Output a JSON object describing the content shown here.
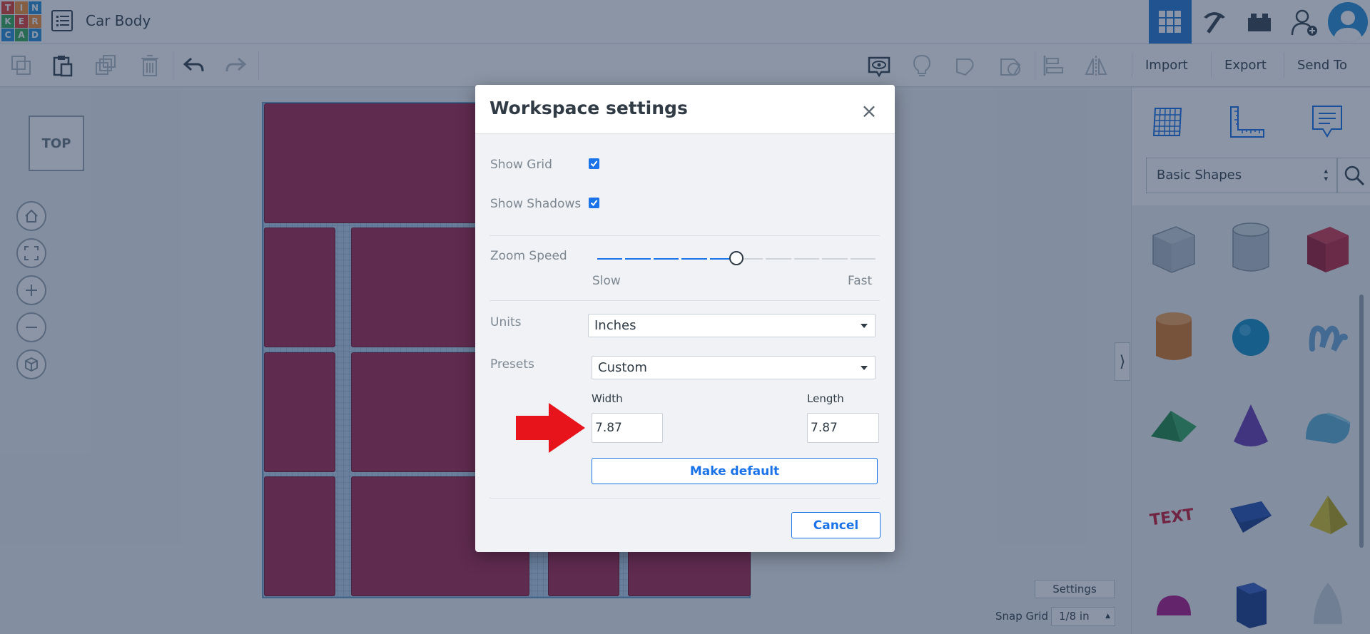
{
  "app": {
    "logo_letters": [
      "T",
      "I",
      "N",
      "K",
      "E",
      "R",
      "C",
      "A",
      "D"
    ],
    "design_title": "Car Body"
  },
  "toolbar": {
    "import_label": "Import",
    "export_label": "Export",
    "send_to_label": "Send To"
  },
  "workplane": {
    "viewcube_label": "TOP",
    "settings_label": "Settings",
    "snap_grid_label": "Snap Grid",
    "snap_grid_value": "1/8 in"
  },
  "right_panel": {
    "shapes_category": "Basic Shapes",
    "shapes": [
      "Box",
      "Cylinder (hole)",
      "Box",
      "Cylinder",
      "Sphere",
      "Scribble",
      "Roof",
      "Cone",
      "Round Roof",
      "Text",
      "Wedge",
      "Pyramid",
      "Half Sphere",
      "Polygon",
      "Paraboloid"
    ],
    "shape_text_label": "TEXT"
  },
  "dialog": {
    "title": "Workspace settings",
    "close_glyph": "×",
    "show_grid_label": "Show Grid",
    "show_grid_checked": true,
    "show_shadows_label": "Show Shadows",
    "show_shadows_checked": true,
    "zoom_speed_label": "Zoom Speed",
    "zoom_speed_level": 0.5,
    "zoom_slow_label": "Slow",
    "zoom_fast_label": "Fast",
    "units_label": "Units",
    "units_value": "Inches",
    "presets_label": "Presets",
    "presets_value": "Custom",
    "width_label": "Width",
    "width_value": "7.87",
    "length_label": "Length",
    "length_value": "7.87",
    "make_default_label": "Make default",
    "cancel_label": "Cancel"
  },
  "colors": {
    "accent": "#1a73e8",
    "shape_fill": "#a62a52",
    "annotation_arrow": "#e8141c",
    "overlay": "rgba(23,44,75,0.5)"
  }
}
